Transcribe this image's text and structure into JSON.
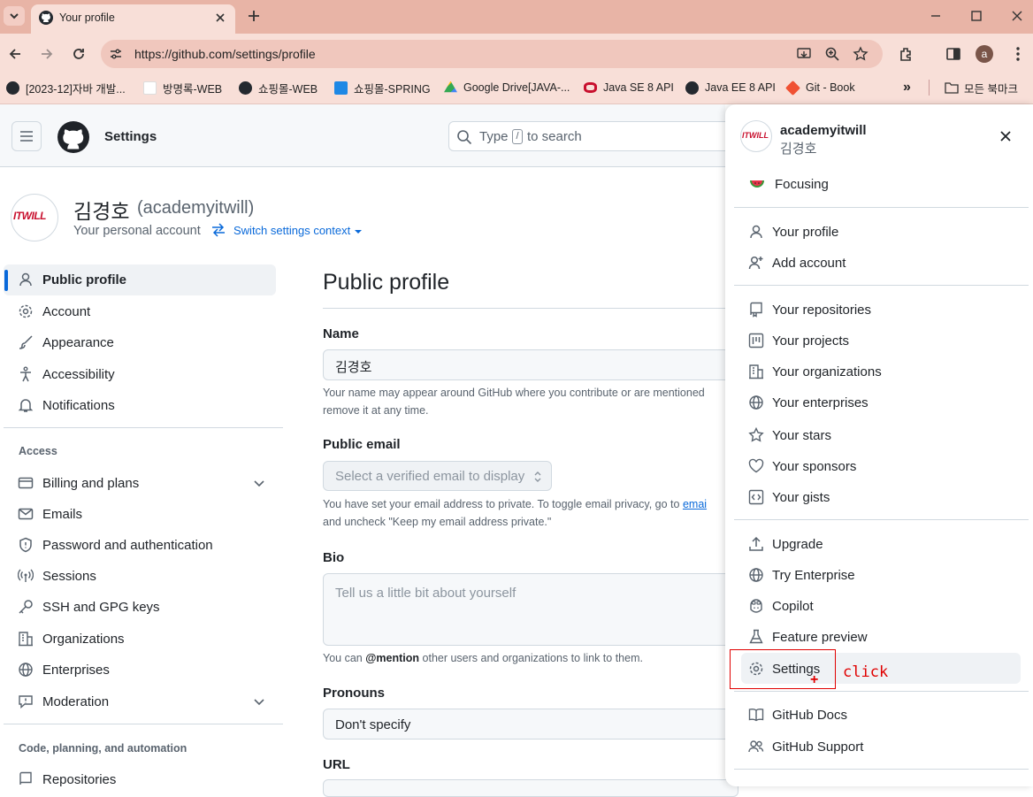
{
  "browser": {
    "tab_title": "Your profile",
    "url": "https://github.com/settings/profile",
    "avatar_letter": "a",
    "bookmarks": [
      {
        "label": "[2023-12]자바 개발...",
        "color": "#24292f"
      },
      {
        "label": "방명록-WEB",
        "color": "#c8102e"
      },
      {
        "label": "쇼핑몰-WEB",
        "color": "#24292f"
      },
      {
        "label": "쇼핑몰-SPRING",
        "color": "#1e88e5"
      },
      {
        "label": "Google Drive[JAVA-...",
        "color": "#34a853"
      },
      {
        "label": "Java SE 8 API",
        "color": "#c8102e"
      },
      {
        "label": "Java EE 8 API",
        "color": "#24292f"
      },
      {
        "label": "Git - Book",
        "color": "#f05133"
      }
    ],
    "all_bookmarks": "모든 북마크"
  },
  "header": {
    "title": "Settings",
    "search_prefix": "Type",
    "search_key": "/",
    "search_suffix": "to search"
  },
  "account": {
    "name": "김경호",
    "username": "(academyitwill)",
    "subtitle": "Your personal account",
    "switch_context": "Switch settings context",
    "logo_text": "ITWILL"
  },
  "sidebar": {
    "items": [
      {
        "label": "Public profile",
        "icon": "person-icon"
      },
      {
        "label": "Account",
        "icon": "gear-icon"
      },
      {
        "label": "Appearance",
        "icon": "paintbrush-icon"
      },
      {
        "label": "Accessibility",
        "icon": "accessibility-icon"
      },
      {
        "label": "Notifications",
        "icon": "bell-icon"
      }
    ],
    "access_heading": "Access",
    "access_items": [
      {
        "label": "Billing and plans",
        "icon": "credit-card-icon"
      },
      {
        "label": "Emails",
        "icon": "mail-icon"
      },
      {
        "label": "Password and authentication",
        "icon": "shield-icon"
      },
      {
        "label": "Sessions",
        "icon": "broadcast-icon"
      },
      {
        "label": "SSH and GPG keys",
        "icon": "key-icon"
      },
      {
        "label": "Organizations",
        "icon": "organization-icon"
      },
      {
        "label": "Enterprises",
        "icon": "globe-icon"
      },
      {
        "label": "Moderation",
        "icon": "report-icon"
      }
    ],
    "code_heading": "Code, planning, and automation",
    "code_items": [
      {
        "label": "Repositories",
        "icon": "repo-icon"
      }
    ]
  },
  "main": {
    "title": "Public profile",
    "name_label": "Name",
    "name_value": "김경호",
    "name_note_1": "Your name may appear around GitHub where you contribute or are mentioned",
    "name_note_2": "remove it at any time.",
    "email_label": "Public email",
    "email_placeholder": "Select a verified email to display",
    "email_note_1": "You have set your email address to private. To toggle email privacy, go to",
    "email_link": "emai",
    "email_note_2": "and uncheck \"Keep my email address private.\"",
    "bio_label": "Bio",
    "bio_placeholder": "Tell us a little bit about yourself",
    "bio_note_prefix": "You can",
    "bio_note_mention": "@mention",
    "bio_note_suffix": "other users and organizations to link to them.",
    "pronouns_label": "Pronouns",
    "pronouns_value": "Don't specify",
    "url_label": "URL"
  },
  "menu": {
    "username": "academyitwill",
    "name": "김경호",
    "status": "Focusing",
    "group1": [
      "Your profile",
      "Add account"
    ],
    "group2": [
      "Your repositories",
      "Your projects",
      "Your organizations",
      "Your enterprises",
      "Your stars",
      "Your sponsors",
      "Your gists"
    ],
    "group3": [
      "Upgrade",
      "Try Enterprise",
      "Copilot",
      "Feature preview",
      "Settings"
    ],
    "group4": [
      "GitHub Docs",
      "GitHub Support"
    ]
  },
  "annotation": {
    "text": "click",
    "color": "#e00000"
  }
}
